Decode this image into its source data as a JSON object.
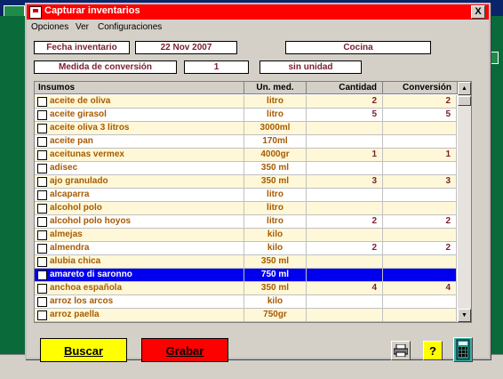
{
  "window": {
    "title": "Capturar inventarios",
    "close_label": "X"
  },
  "menu": [
    "Opciones",
    "Ver",
    "Configuraciones"
  ],
  "header": {
    "fecha_label": "Fecha inventario",
    "fecha_value": "22 Nov 2007",
    "location": "Cocina",
    "medida_label": "Medida de conversión",
    "medida_value": "1",
    "unidad": "sin unidad"
  },
  "grid": {
    "columns": [
      "Insumos",
      "Un. med.",
      "Cantidad",
      "Conversión"
    ],
    "rows": [
      {
        "name": "aceite de oliva",
        "unit": "litro",
        "qty": "2",
        "conv": "2",
        "alt": true
      },
      {
        "name": "aceite girasol",
        "unit": "litro",
        "qty": "5",
        "conv": "5",
        "alt": false
      },
      {
        "name": "aceite oliva 3 litros",
        "unit": "3000ml",
        "qty": "",
        "conv": "",
        "alt": true
      },
      {
        "name": "aceite pan",
        "unit": "170ml",
        "qty": "",
        "conv": "",
        "alt": false
      },
      {
        "name": "aceitunas vermex",
        "unit": "4000gr",
        "qty": "1",
        "conv": "1",
        "alt": true
      },
      {
        "name": "adisec",
        "unit": "350 ml",
        "qty": "",
        "conv": "",
        "alt": false
      },
      {
        "name": "ajo granulado",
        "unit": "350 ml",
        "qty": "3",
        "conv": "3",
        "alt": true
      },
      {
        "name": "alcaparra",
        "unit": "litro",
        "qty": "",
        "conv": "",
        "alt": false
      },
      {
        "name": "alcohol polo",
        "unit": "litro",
        "qty": "",
        "conv": "",
        "alt": true
      },
      {
        "name": "alcohol polo hoyos",
        "unit": "litro",
        "qty": "2",
        "conv": "2",
        "alt": false
      },
      {
        "name": "almejas",
        "unit": "kilo",
        "qty": "",
        "conv": "",
        "alt": true
      },
      {
        "name": "almendra",
        "unit": "kilo",
        "qty": "2",
        "conv": "2",
        "alt": false
      },
      {
        "name": "alubia chica",
        "unit": "350 ml",
        "qty": "",
        "conv": "",
        "alt": true
      },
      {
        "name": "amareto di saronno",
        "unit": "750 ml",
        "qty": "",
        "conv": "",
        "alt": false,
        "selected": true
      },
      {
        "name": "anchoa española",
        "unit": "350 ml",
        "qty": "4",
        "conv": "4",
        "alt": true
      },
      {
        "name": "arroz los arcos",
        "unit": "kilo",
        "qty": "",
        "conv": "",
        "alt": false
      },
      {
        "name": "arroz paella",
        "unit": "750gr",
        "qty": "",
        "conv": "",
        "alt": true
      }
    ]
  },
  "buttons": {
    "buscar": "Buscar",
    "grabar": "Grabar"
  },
  "colors": {
    "title_bar": "#ff0000",
    "buscar": "#ffff00",
    "grabar": "#ff0000",
    "selection": "#0000ee",
    "alt_row": "#fff8d8"
  },
  "icons": [
    "printer-icon",
    "help-icon",
    "calculator-icon"
  ]
}
